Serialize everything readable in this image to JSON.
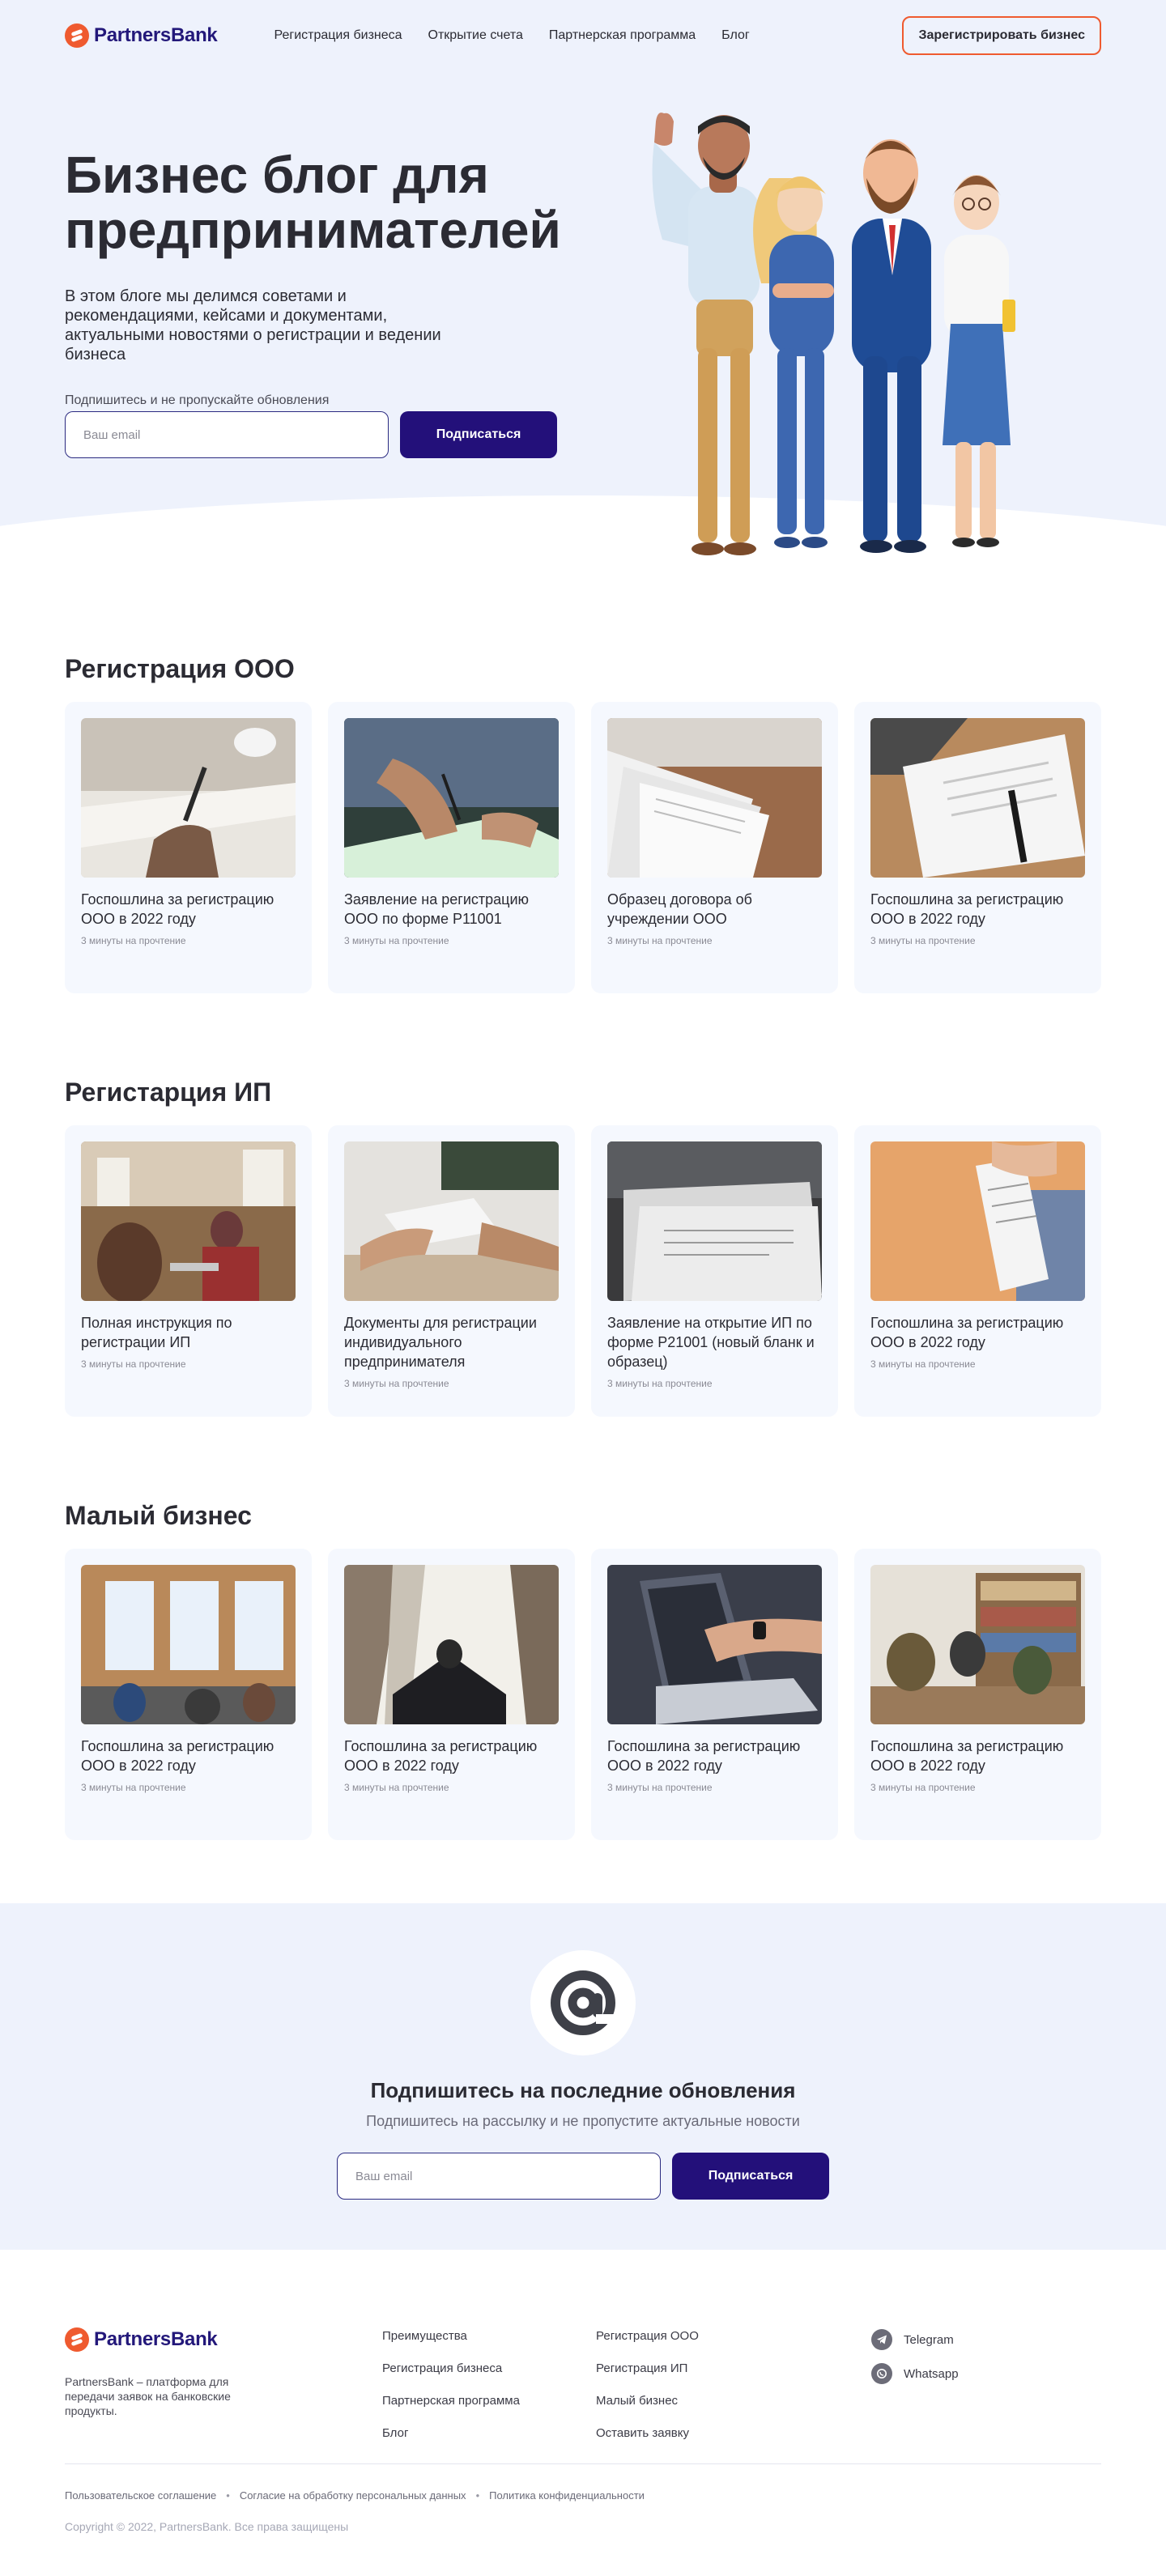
{
  "brand": {
    "name": "PartnersBank"
  },
  "nav": {
    "items": [
      {
        "label": "Регистрация бизнеса"
      },
      {
        "label": "Открытие счета"
      },
      {
        "label": "Партнерская программа"
      },
      {
        "label": "Блог"
      }
    ],
    "cta_label": "Зарегистрировать бизнес"
  },
  "hero": {
    "title": "Бизнес блог для предпринимателей",
    "description": "В этом блоге мы делимся советами и рекомендациями, кейсами и документами, актуальными новостями о регистрации и ведении бизнеса",
    "subscribe_label": "Подпишитесь и не пропускайте обновления",
    "email_placeholder": "Ваш email",
    "button_label": "Подписаться"
  },
  "sections": [
    {
      "title": "Регистрация ООО",
      "cards": [
        {
          "title": "Госпошлина за регистрацию ООО в 2022 году",
          "meta": "3 минуты на прочтение",
          "image": "hand-writing-notebook"
        },
        {
          "title": "Заявление на регистрацию ООО по форме Р11001",
          "meta": "3 минуты на прочтение",
          "image": "signing-document"
        },
        {
          "title": "Образец договора об учреждении ООО",
          "meta": "3 минуты на прочтение",
          "image": "papers-on-desk"
        },
        {
          "title": "Госпошлина за регистрацию ООО в 2022 году",
          "meta": "3 минуты на прочтение",
          "image": "form-with-pen"
        }
      ]
    },
    {
      "title": "Регистарция ИП",
      "cards": [
        {
          "title": "Полная инструкция по регистрации ИП",
          "meta": "3 минуты на прочтение",
          "image": "people-in-cafe"
        },
        {
          "title": "Документы для регистрации индивидуального предпринимателя",
          "meta": "3 минуты на прочтение",
          "image": "passing-documents"
        },
        {
          "title": "Заявление на открытие ИП по форме Р21001 (новый бланк и образец)",
          "meta": "3 минуты на прочтение",
          "image": "document-stack"
        },
        {
          "title": "Госпошлина за регистрацию ООО в 2022 году",
          "meta": "3 минуты на прочтение",
          "image": "receipt-in-hand"
        }
      ]
    },
    {
      "title": "Малый бизнес",
      "cards": [
        {
          "title": "Госпошлина за регистрацию ООО в 2022 году",
          "meta": "3 минуты на прочтение",
          "image": "office-meeting"
        },
        {
          "title": "Госпошлина за регистрацию ООО в 2022 году",
          "meta": "3 минуты на прочтение",
          "image": "man-among-skyscrapers"
        },
        {
          "title": "Госпошлина за регистрацию ООО в 2022 году",
          "meta": "3 минуты на прочтение",
          "image": "laptop-hands"
        },
        {
          "title": "Госпошлина за регистрацию ООО в 2022 году",
          "meta": "3 минуты на прочтение",
          "image": "people-in-library"
        }
      ]
    }
  ],
  "subscribe": {
    "title": "Подпишитесь на последние обновления",
    "subtitle": "Подпишитесь на рассылку и не пропустите актуальные новости",
    "email_placeholder": "Ваш email",
    "button_label": "Подписаться",
    "icon": "at-sign-icon"
  },
  "footer": {
    "description": "PartnersBank – платформа для передачи заявок на банковские продукты.",
    "col1": [
      {
        "label": "Преимущества"
      },
      {
        "label": "Регистрация бизнеса"
      },
      {
        "label": "Партнерская программа"
      },
      {
        "label": "Блог"
      }
    ],
    "col2": [
      {
        "label": "Регистрация ООО"
      },
      {
        "label": "Регистрация ИП"
      },
      {
        "label": "Малый бизнес"
      },
      {
        "label": "Оставить заявку"
      }
    ],
    "social": [
      {
        "label": "Telegram",
        "icon": "telegram-icon"
      },
      {
        "label": "Whatsapp",
        "icon": "whatsapp-icon"
      }
    ],
    "legal": [
      {
        "label": "Пользовательское соглашение"
      },
      {
        "label": "Согласие на обработку персональных данных"
      },
      {
        "label": "Политика конфиденциальности"
      }
    ],
    "copyright": "Copyright © 2022, PartnersBank. Все права защищены"
  },
  "colors": {
    "brand_navy": "#23107a",
    "accent_orange": "#ef5a2f",
    "hero_bg": "#eef2fc",
    "card_bg": "#f5f8fe"
  }
}
